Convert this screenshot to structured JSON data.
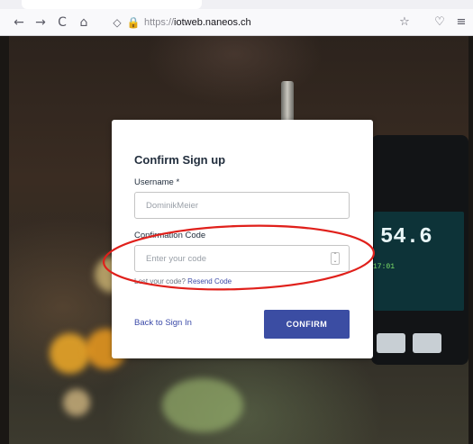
{
  "browser": {
    "back_icon": "←",
    "forward_icon": "→",
    "reload_icon": "C",
    "home_icon": "⌂",
    "shield_icon": "◇",
    "lock_icon": "🔒",
    "url_scheme": "https://",
    "url_host": "iotweb.naneos.ch",
    "bookmark_icon": "☆",
    "pocket_icon": "♡",
    "menu_icon": "≡"
  },
  "device": {
    "reading": "54.6",
    "sub_reading": "17:01"
  },
  "form": {
    "title": "Confirm Sign up",
    "username_label": "Username *",
    "username_value": "DominikMeier",
    "code_label": "Confirmation Code",
    "code_placeholder": "Enter your code",
    "lost_code_text": "Lost your code?",
    "resend_label": "Resend Code",
    "back_label": "Back to Sign In",
    "confirm_label": "CONFIRM"
  },
  "colors": {
    "accent": "#3b4da3",
    "annotation": "#e0201b"
  }
}
